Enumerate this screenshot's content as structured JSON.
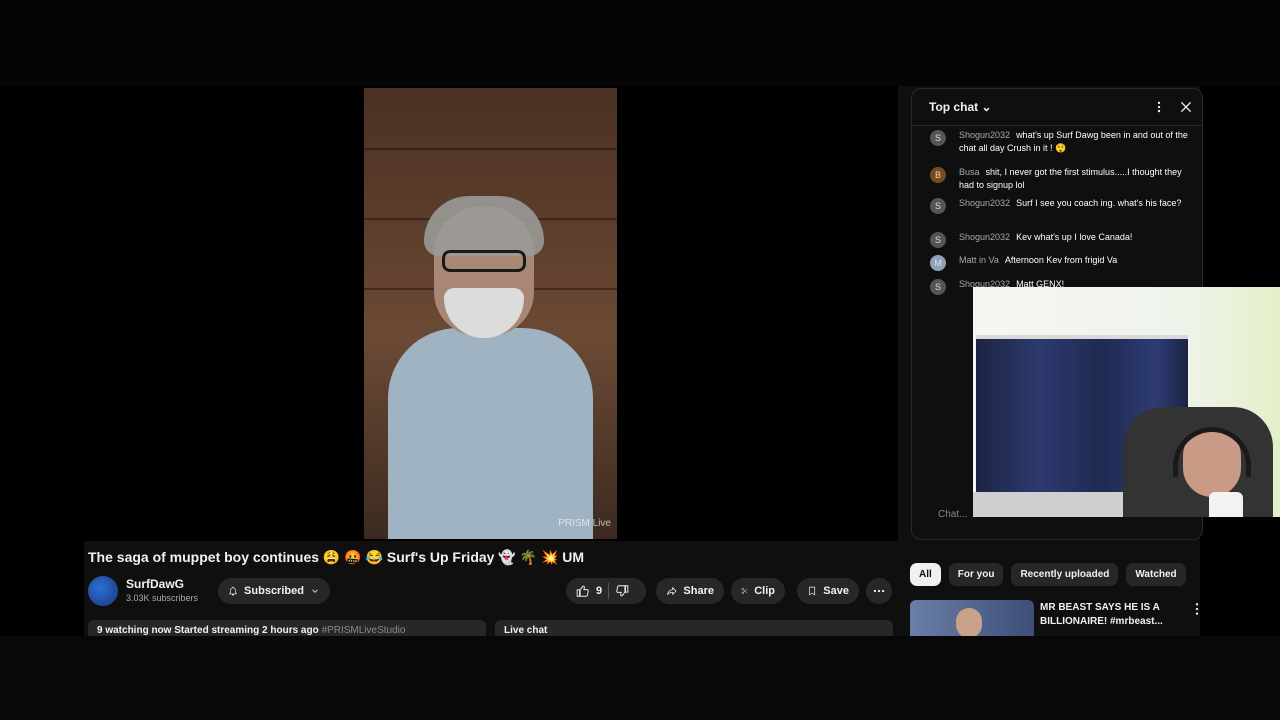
{
  "video": {
    "title": "The saga of muppet boy continues 😩 🤬 😂 Surf's Up Friday 👻 🌴 💥 UM",
    "watermark": "PRISM Live"
  },
  "channel": {
    "name": "SurfDawG",
    "subscribers": "3.03K subscribers",
    "subscribe_label": "Subscribed"
  },
  "actions": {
    "likes": "9",
    "share": "Share",
    "clip": "Clip",
    "save": "Save"
  },
  "description": {
    "stats": "9 watching now  Started streaming 2 hours ago",
    "hashtag": "#PRISMLiveStudio"
  },
  "live_chat_label": "Live chat",
  "chat": {
    "title": "Top chat",
    "input_placeholder": "Chat...",
    "messages": [
      {
        "author": "Shogun2032",
        "avatar": "S",
        "text": "what's up Surf Dawg been in and out of the chat all day Crush in it ! 😲"
      },
      {
        "author": "Busa",
        "avatar": "B",
        "text": "shit, I never got the first stimulus.....I thought they had to signup lol"
      },
      {
        "author": "Shogun2032",
        "avatar": "S",
        "text": "Surf I see you coach ing. what's his face?"
      },
      {
        "author": "Shogun2032",
        "avatar": "S",
        "text": "Kev what's up I love Canada!"
      },
      {
        "author": "Matt in Va",
        "avatar": "M",
        "text": "Afternoon Kev from frigid Va"
      },
      {
        "author": "Shogun2032",
        "avatar": "S",
        "text": "Matt GENX!"
      }
    ]
  },
  "filters": [
    "All",
    "For you",
    "Recently uploaded",
    "Watched"
  ],
  "recommendation": {
    "title": "MR BEAST SAYS HE IS A BILLIONAIRE! #mrbeast..."
  },
  "colors": {
    "background": "#0f0f0f",
    "pill": "#272727",
    "text": "#f1f1f1",
    "secondary_text": "#aaaaaa"
  }
}
